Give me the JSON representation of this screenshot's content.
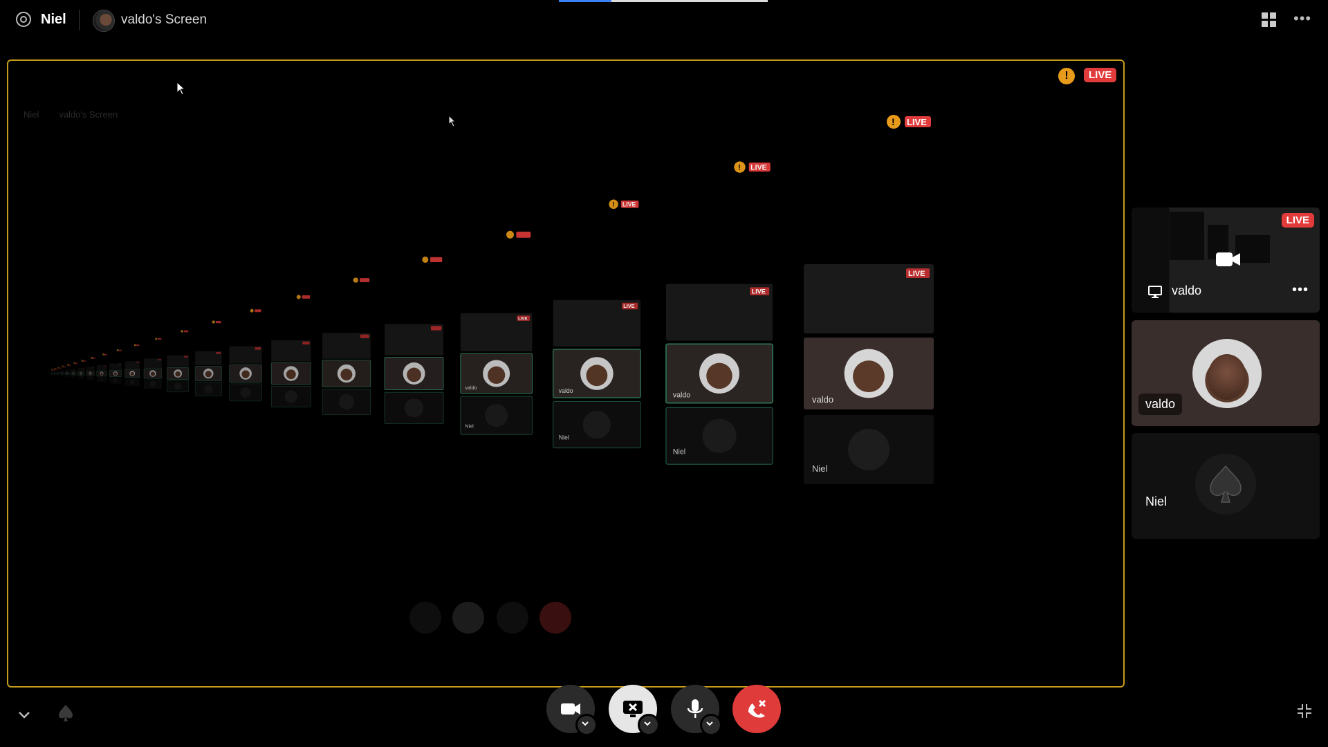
{
  "header": {
    "user": "Niel",
    "stream_title": "valdo's Screen",
    "progress": 0.25
  },
  "main_stage": {
    "live_label": "LIVE",
    "warn_symbol": "!",
    "accent_color": "#c79c1a"
  },
  "side_panel": {
    "stream_tile": {
      "live_label": "LIVE",
      "owner": "valdo"
    },
    "camera_tile": {
      "name": "valdo"
    },
    "audio_tile": {
      "name": "Niel"
    }
  },
  "recursion_tiles": [
    {
      "label": "valdo",
      "audio_label": "Niel"
    }
  ],
  "controls": {
    "camera": "camera-button",
    "screen": "stop-screen-share-button",
    "mic": "microphone-button",
    "hangup": "disconnect-button",
    "hangup_color": "#e03b3b"
  },
  "icons": [
    "at-icon",
    "grid-icon",
    "more-icon",
    "camera-icon",
    "monitor-icon",
    "spade-icon",
    "chevron-down-icon",
    "exit-fullscreen-icon",
    "warning-icon"
  ]
}
